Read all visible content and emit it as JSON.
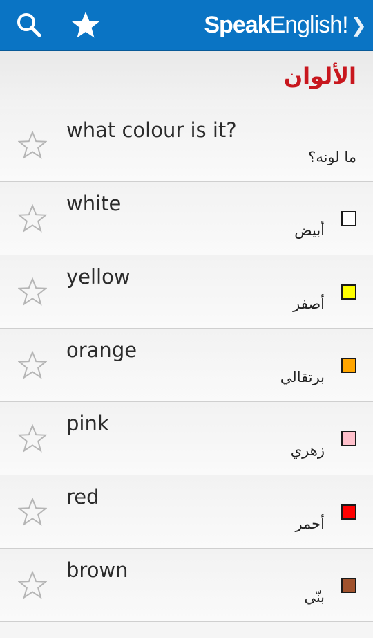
{
  "header": {
    "brand_bold": "Speak",
    "brand_regular": "English!",
    "brand_chevron": "❯",
    "icons": [
      "search-icon",
      "star-icon"
    ],
    "color": "#0a74c4"
  },
  "section": {
    "title": "الألوان",
    "title_color": "#c8171e"
  },
  "items": [
    {
      "en": "what colour is it?",
      "ar": "ما لونه؟",
      "swatch": null
    },
    {
      "en": "white",
      "ar": "أبيض",
      "swatch": "#ffffff"
    },
    {
      "en": "yellow",
      "ar": "أصفر",
      "swatch": "#ffff00"
    },
    {
      "en": "orange",
      "ar": "برتقالي",
      "swatch": "#ffa500"
    },
    {
      "en": "pink",
      "ar": "زهري",
      "swatch": "#ffc0cb"
    },
    {
      "en": "red",
      "ar": "أحمر",
      "swatch": "#ff0000"
    },
    {
      "en": "brown",
      "ar": "بنّي",
      "swatch": "#a0522d"
    }
  ]
}
